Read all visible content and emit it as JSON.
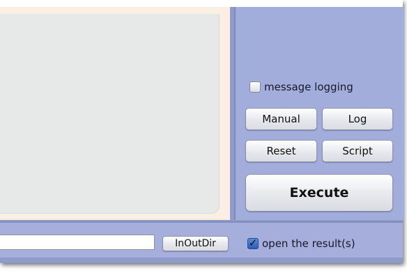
{
  "right_panel": {
    "message_logging": {
      "label": "message logging",
      "checked": false
    },
    "buttons": {
      "manual": "Manual",
      "log": "Log",
      "reset": "Reset",
      "script": "Script",
      "execute": "Execute"
    }
  },
  "bottom_bar": {
    "path_value": "",
    "inoutdir_label": "InOutDir",
    "open_result": {
      "label": "open the result(s)",
      "checked": true
    }
  },
  "colors": {
    "panel_blue": "#a3addc",
    "frame_blue": "#8f9cc9",
    "canvas_gray": "#e7e9e8",
    "canvas_frame_peach": "#fbeee3",
    "checkbox_blue": "#2a5db5"
  }
}
